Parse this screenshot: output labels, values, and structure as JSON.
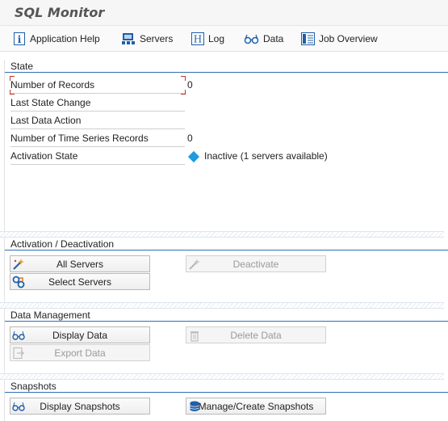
{
  "app": {
    "title": "SQL Monitor"
  },
  "toolbar": {
    "items": [
      {
        "label": "Application Help",
        "icon": "info-icon"
      },
      {
        "label": "Servers",
        "icon": "servers-icon"
      },
      {
        "label": "Log",
        "icon": "log-icon"
      },
      {
        "label": "Data",
        "icon": "glasses-icon"
      },
      {
        "label": "Job Overview",
        "icon": "job-overview-icon"
      }
    ]
  },
  "state": {
    "header": "State",
    "rows": [
      {
        "label": "Number of Records",
        "value": "0"
      },
      {
        "label": "Last State Change",
        "value": ""
      },
      {
        "label": "Last Data Action",
        "value": ""
      },
      {
        "label": "Number of Time Series Records",
        "value": "0"
      },
      {
        "label": "Activation State",
        "value": "Inactive (1 servers available)",
        "status_color": "#1e9be0"
      }
    ]
  },
  "activation": {
    "header": "Activation / Deactivation",
    "all_servers": "All Servers",
    "deactivate": "Deactivate",
    "select_servers": "Select Servers"
  },
  "data_management": {
    "header": "Data Management",
    "display_data": "Display Data",
    "delete_data": "Delete Data",
    "export_data": "Export Data"
  },
  "snapshots": {
    "header": "Snapshots",
    "display_snapshots": "Display Snapshots",
    "manage_snapshots": "Manage/Create Snapshots"
  },
  "colors": {
    "accent": "#2f6fb5",
    "status_inactive": "#1e9be0",
    "icon_blue": "#1f5fa8"
  }
}
